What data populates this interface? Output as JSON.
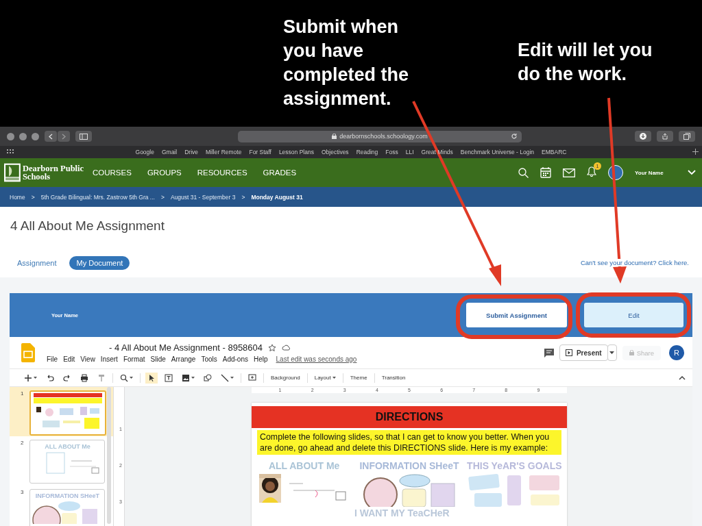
{
  "annotations": [
    {
      "text": "Submit when you have completed the assignment.",
      "kind": "callout"
    },
    {
      "text": "Edit will let you do the work.",
      "kind": "callout"
    }
  ],
  "browser": {
    "url": "dearbornschools.schoology.com",
    "bookmarks": [
      "Google",
      "Gmail",
      "Drive",
      "Miller Remote",
      "For Staff",
      "Lesson Plans",
      "Objectives",
      "Reading",
      "Foss",
      "LLI",
      "Great Minds",
      "Benchmark Universe - Login",
      "EMBARC"
    ]
  },
  "site_nav": {
    "logo_text": "Dearborn Public Schools",
    "items": [
      "COURSES",
      "GROUPS",
      "RESOURCES",
      "GRADES"
    ],
    "notification_count": "1",
    "user_name": "Your Name"
  },
  "breadcrumb": [
    {
      "label": "Home",
      "current": false
    },
    {
      "label": "5th Grade Bilingual: Mrs. Zastrow 5th Gra ...",
      "current": false
    },
    {
      "label": "August 31 - September 3",
      "current": false
    },
    {
      "label": "Monday August 31",
      "current": true
    }
  ],
  "breadcrumb_separator": ">",
  "page_title": "4 All About Me Assignment",
  "tabs": [
    {
      "label": "Assignment",
      "selected": false
    },
    {
      "label": "My Document",
      "selected": true
    }
  ],
  "help_link": "Can't see your document? Click here.",
  "banner": {
    "user_name": "Your Name",
    "buttons": [
      {
        "label": "Submit Assignment",
        "kind": "submit"
      },
      {
        "label": "Edit",
        "kind": "edit"
      }
    ]
  },
  "doc": {
    "title": " - 4 All About Me Assignment - 8958604",
    "menu": [
      "File",
      "Edit",
      "View",
      "Insert",
      "Format",
      "Slide",
      "Arrange",
      "Tools",
      "Add-ons",
      "Help"
    ],
    "last_edit": "Last edit was seconds ago",
    "present": "Present",
    "share": {
      "label": "Share",
      "disabled": true
    },
    "avatar": "R",
    "toolbar_text": [
      {
        "label": "Background",
        "dropdown": false
      },
      {
        "label": "Layout",
        "dropdown": true
      },
      {
        "label": "Theme",
        "dropdown": false
      },
      {
        "label": "Transition",
        "dropdown": false
      }
    ],
    "ruler": [
      "1",
      "2",
      "3",
      "4",
      "5",
      "6",
      "7",
      "8",
      "9"
    ],
    "vruler": [
      "1",
      "2",
      "3"
    ],
    "thumbnails": [
      {
        "number": "1",
        "selected": true,
        "kind": "directions"
      },
      {
        "number": "2",
        "selected": false,
        "kind": "about",
        "title": "ALL ABOUT Me"
      },
      {
        "number": "3",
        "selected": false,
        "kind": "info",
        "title": "INFORMATION SHeeT"
      }
    ],
    "slide": {
      "heading": "DIRECTIONS",
      "instructions": "Complete the following slides, so that I can get to know you better. When you are done, go ahead and delete this DIRECTIONS slide. Here is my example:",
      "examples": [
        {
          "title": "ALL ABOUT Me",
          "kind": "about"
        },
        {
          "title": "INFORMATION SHeeT",
          "kind": "info"
        },
        {
          "title": "THIS YeAR'S GOALS",
          "kind": "goals"
        }
      ],
      "lower_title": "I WANT MY TeaCHeR"
    }
  }
}
